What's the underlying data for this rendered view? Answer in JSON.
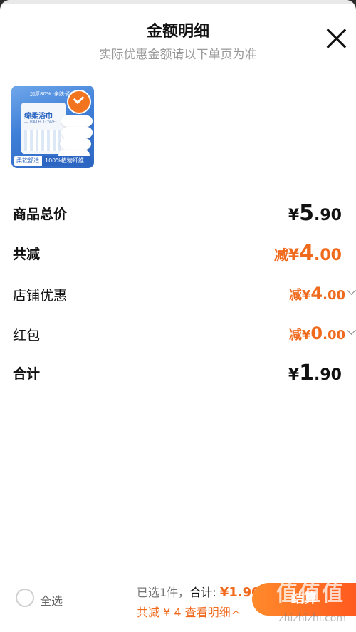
{
  "header": {
    "title": "金额明细",
    "subtitle": "实际优惠金额请以下单页为准"
  },
  "product": {
    "image_top_tag": "加厚80% ·亲肤·柔软",
    "pack_title": "绵柔浴巾",
    "pack_sub": "— BATH TOWEL",
    "tag1": "柔软舒适",
    "tag2": "100%植物纤维"
  },
  "rows": [
    {
      "label": "商品总价",
      "currency": "¥",
      "int": "5",
      "dec": ".90"
    },
    {
      "label": "共减",
      "prefix": "减",
      "currency": "¥",
      "int": "4",
      "dec": ".00"
    },
    {
      "label": "店铺优惠",
      "prefix": "减",
      "currency": "¥",
      "int": "4",
      "dec": ".00"
    },
    {
      "label": "红包",
      "prefix": "减",
      "currency": "¥",
      "int": "0",
      "dec": ".00"
    },
    {
      "label": "合计",
      "currency": "¥",
      "int": "1",
      "dec": ".90"
    }
  ],
  "footer": {
    "select_all": "全选",
    "selected_text": "已选1件，",
    "total_label": "合计:",
    "total_amount": "¥1.90",
    "discount_detail": "共减 ¥ 4  查看明细",
    "checkout_label": "结算",
    "watermark": "值值值",
    "watermark_url": "zhizhizhi.com"
  },
  "colors": {
    "accent": "#f06a1d",
    "text": "#111111",
    "muted": "#999999"
  }
}
